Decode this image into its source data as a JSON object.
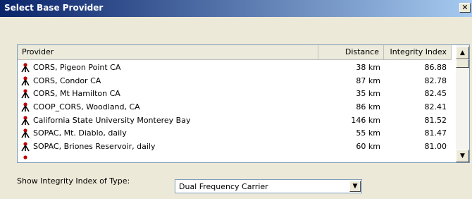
{
  "window": {
    "title": "Select Base Provider",
    "close_glyph": "✕"
  },
  "table": {
    "headers": {
      "provider": "Provider",
      "distance": "Distance",
      "integrity": "Integrity Index"
    },
    "rows": [
      {
        "provider": "CORS, Pigeon Point CA",
        "distance": "38 km",
        "integrity": "86.88"
      },
      {
        "provider": "CORS, Condor CA",
        "distance": "87 km",
        "integrity": "82.78"
      },
      {
        "provider": "CORS, Mt Hamilton CA",
        "distance": "35 km",
        "integrity": "82.45"
      },
      {
        "provider": "COOP_CORS, Woodland, CA",
        "distance": "86 km",
        "integrity": "82.41"
      },
      {
        "provider": "California State University Monterey Bay",
        "distance": "146 km",
        "integrity": "81.52"
      },
      {
        "provider": "SOPAC, Mt. Diablo, daily",
        "distance": "55 km",
        "integrity": "81.47"
      },
      {
        "provider": "SOPAC, Briones Reservoir, daily",
        "distance": "60 km",
        "integrity": "81.00"
      }
    ],
    "row_icon": "survey-tripod-icon",
    "scroll": {
      "up_glyph": "▲",
      "down_glyph": "▼"
    }
  },
  "filter": {
    "label": "Show Integrity Index of Type:",
    "value": "Dual Frequency Carrier",
    "dropdown_glyph": "▼"
  }
}
